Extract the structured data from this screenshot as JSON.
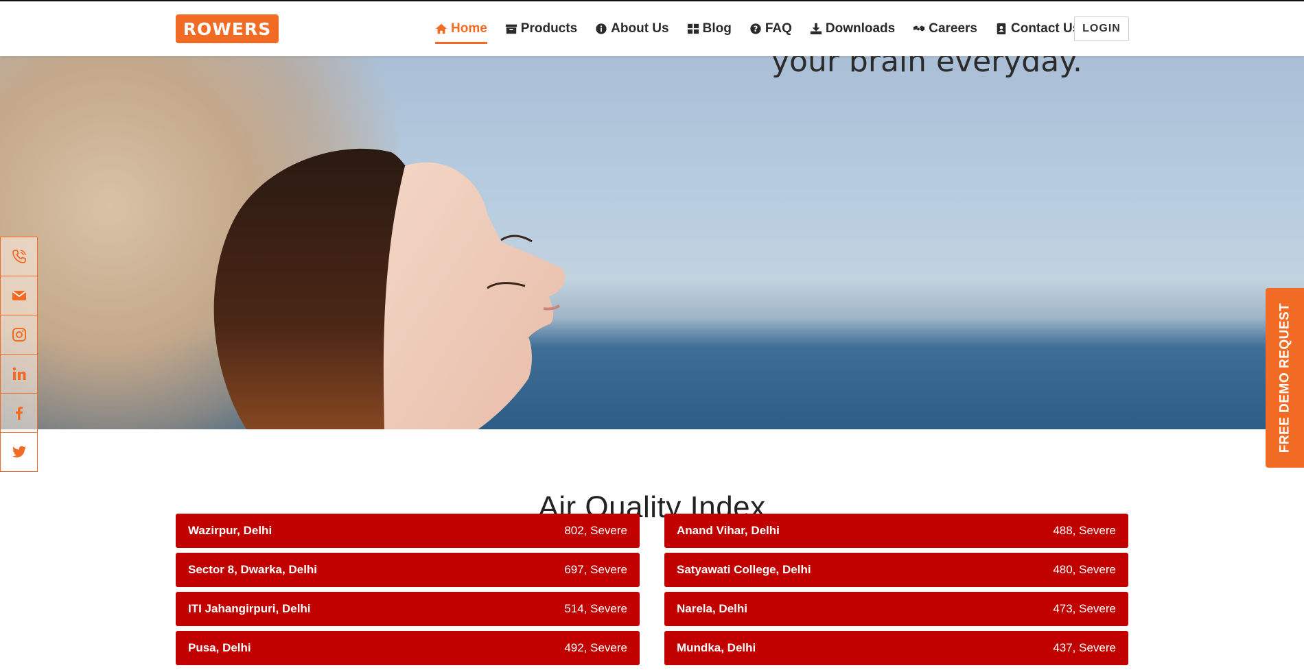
{
  "brand": {
    "logo_text": "ROWERS",
    "accent_color": "#f26b25"
  },
  "nav": {
    "items": [
      {
        "label": "Home",
        "icon": "home-icon",
        "active": true
      },
      {
        "label": "Products",
        "icon": "archive-box-icon"
      },
      {
        "label": "About Us",
        "icon": "info-circle-icon"
      },
      {
        "label": "Blog",
        "icon": "grid-icon"
      },
      {
        "label": "FAQ",
        "icon": "question-circle-icon"
      },
      {
        "label": "Downloads",
        "icon": "download-icon"
      },
      {
        "label": "Careers",
        "icon": "handshake-icon"
      },
      {
        "label": "Contact Us",
        "icon": "contact-card-icon"
      }
    ],
    "login_label": "LOGIN"
  },
  "hero": {
    "tagline": "your brain everyday."
  },
  "social": {
    "icons": [
      "phone-icon",
      "email-icon",
      "instagram-icon",
      "linkedin-icon",
      "facebook-icon",
      "twitter-icon"
    ]
  },
  "demo_tab": {
    "label": "FREE DEMO REQUEST"
  },
  "aqi": {
    "title": "Air Quality Index",
    "status_color": "#c10000",
    "left": [
      {
        "city": "Wazirpur, Delhi",
        "value": "802, Severe"
      },
      {
        "city": "Sector 8, Dwarka, Delhi",
        "value": "697, Severe"
      },
      {
        "city": "ITI Jahangirpuri, Delhi",
        "value": "514, Severe"
      },
      {
        "city": "Pusa, Delhi",
        "value": "492, Severe"
      }
    ],
    "right": [
      {
        "city": "Anand Vihar, Delhi",
        "value": "488, Severe"
      },
      {
        "city": "Satyawati College, Delhi",
        "value": "480, Severe"
      },
      {
        "city": "Narela, Delhi",
        "value": "473, Severe"
      },
      {
        "city": "Mundka, Delhi",
        "value": "437, Severe"
      }
    ]
  }
}
